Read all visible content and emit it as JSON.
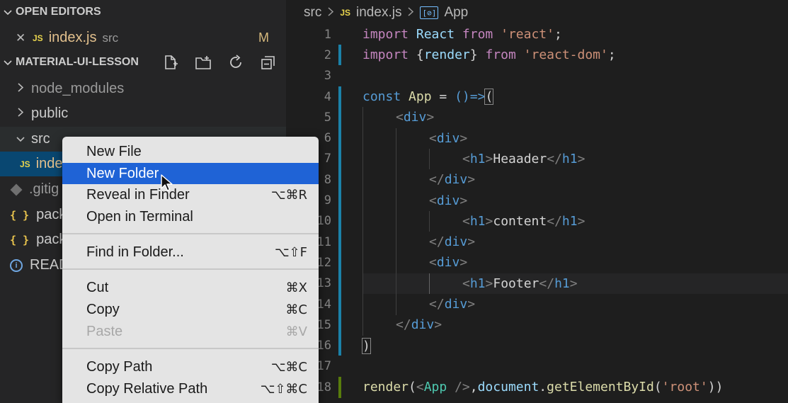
{
  "sidebar": {
    "open_editors": {
      "title": "OPEN EDITORS"
    },
    "open_file": {
      "close": "✕",
      "badge": "JS",
      "name": "index.js",
      "folder": "src",
      "status": "M"
    },
    "project": {
      "title": "MATERIAL-UI-LESSON"
    },
    "tree": [
      {
        "name": "node_modules",
        "kind": "folder"
      },
      {
        "name": "public",
        "kind": "folder"
      },
      {
        "name": "src",
        "kind": "folder"
      },
      {
        "name": "index.js",
        "kind": "js",
        "visible": "inde"
      },
      {
        "name": ".gitignore",
        "kind": "git",
        "visible": ".gitig"
      },
      {
        "name": "package.json",
        "kind": "json",
        "visible": "pack"
      },
      {
        "name": "package-lock.json",
        "kind": "json",
        "visible": "pack"
      },
      {
        "name": "README.md",
        "kind": "info",
        "visible": "READ"
      }
    ],
    "icons": {
      "braces": "{ }",
      "info": "i"
    }
  },
  "breadcrumb": {
    "folder": "src",
    "badge": "JS",
    "file": "index.js",
    "symbol_icon": "[⊘]",
    "symbol": "App"
  },
  "code": {
    "line_numbers": [
      "1",
      "2",
      "3",
      "4",
      "5",
      "6",
      "7",
      "8",
      "9",
      "10",
      "11",
      "12",
      "13",
      "14",
      "15",
      "16",
      "17",
      "18"
    ],
    "l1": {
      "a": "import",
      "b": "React",
      "c": "from",
      "d": "'react'",
      "e": ";"
    },
    "l2": {
      "a": "import",
      "b": "{",
      "c": "render",
      "d": "}",
      "e": "from",
      "f": "'react-dom'",
      "g": ";"
    },
    "l4": {
      "a": "const",
      "b": "App",
      "c": "=",
      "d": "()=>",
      "e": "("
    },
    "tags": {
      "div_open": "div",
      "h1": "h1",
      "lt": "<",
      "gt": ">",
      "lts": "</"
    },
    "l7_text": "Heaader",
    "l10_text": "content",
    "l13_text": "Footer",
    "l16": ")",
    "l18": {
      "a": "render",
      "b": "(",
      "c": "<",
      "d": "App",
      "e": " />",
      "f": ",",
      "g": "document",
      "h": ".",
      "i": "getElementById",
      "j": "(",
      "k": "'root'",
      "l": "))"
    }
  },
  "context_menu": {
    "items": [
      {
        "label": "New File",
        "shortcut": ""
      },
      {
        "label": "New Folder",
        "shortcut": ""
      },
      {
        "label": "Reveal in Finder",
        "shortcut": "⌥⌘R"
      },
      {
        "label": "Open in Terminal",
        "shortcut": ""
      },
      {
        "label": "Find in Folder...",
        "shortcut": "⌥⇧F"
      },
      {
        "label": "Cut",
        "shortcut": "⌘X"
      },
      {
        "label": "Copy",
        "shortcut": "⌘C"
      },
      {
        "label": "Paste",
        "shortcut": "⌘V"
      },
      {
        "label": "Copy Path",
        "shortcut": "⌥⌘C"
      },
      {
        "label": "Copy Relative Path",
        "shortcut": "⌥⇧⌘C"
      }
    ],
    "highlighted": "New Folder",
    "disabled": [
      "Paste"
    ]
  },
  "colors": {
    "menu_highlight": "#1f63d6",
    "modified": "#d7ba7d",
    "js_badge": "#e8d44d"
  }
}
